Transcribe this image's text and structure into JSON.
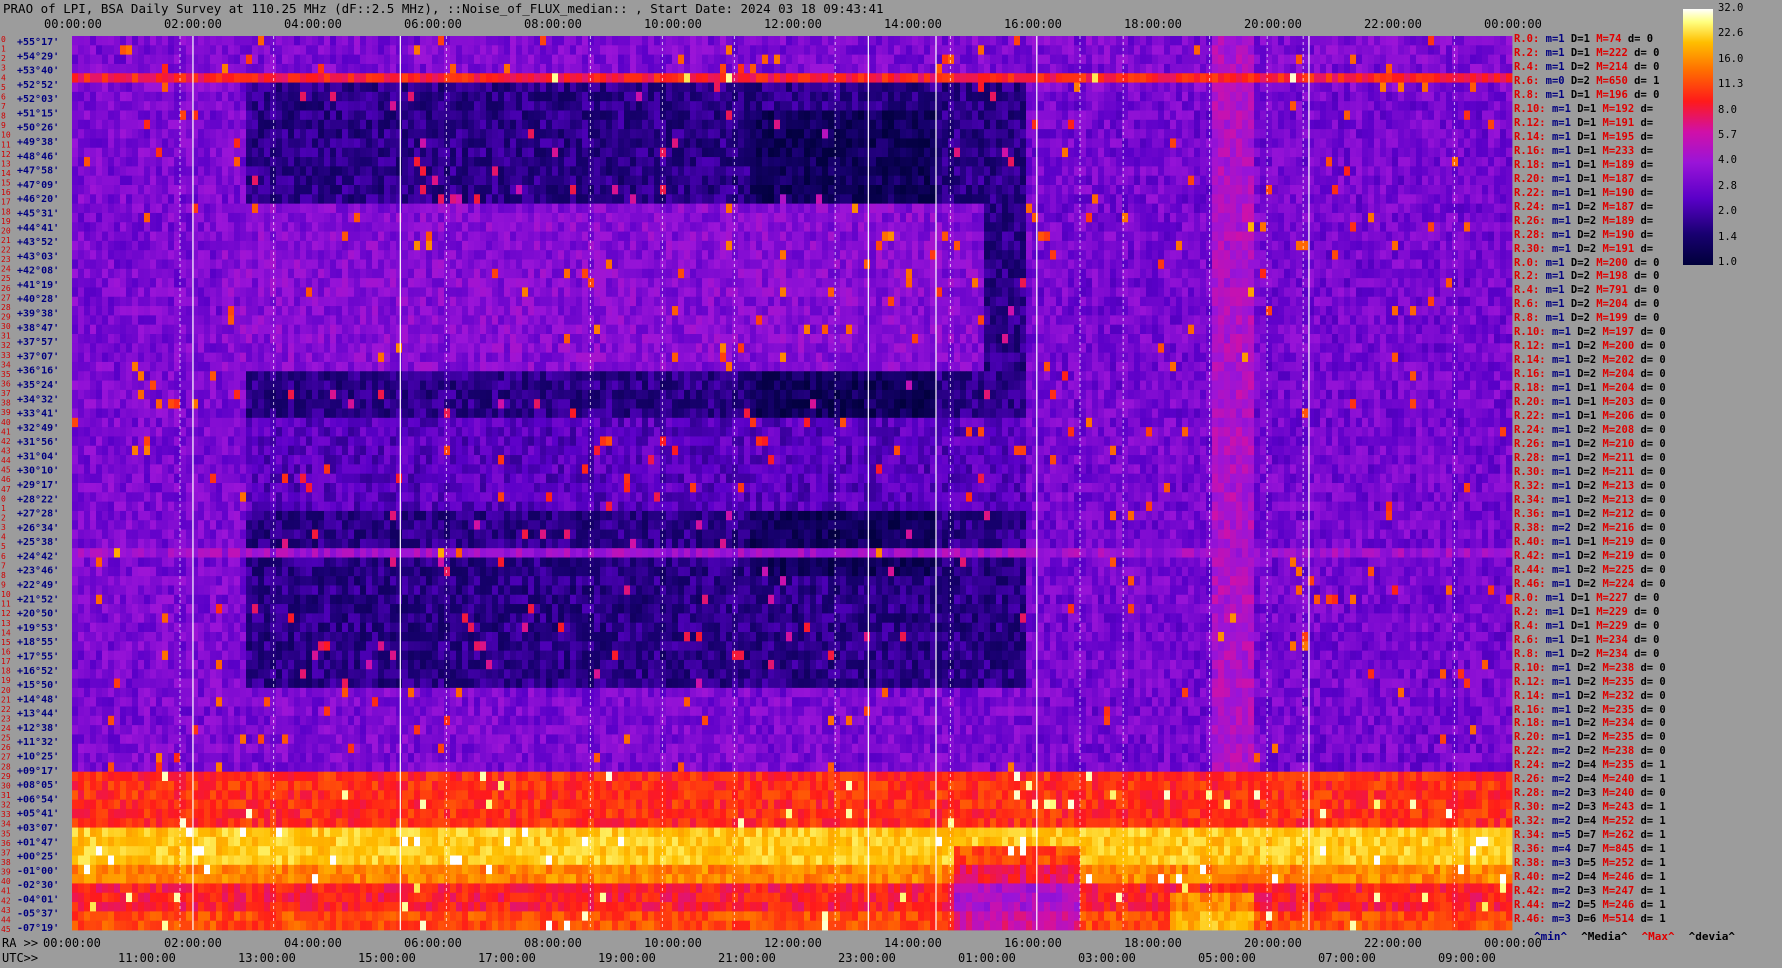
{
  "title": "PRAO of LPI, BSA Daily Survey at 110.25 MHz (dF::2.5 MHz), ::Noise_of_FLUX_median:: , Start Date: 2024 03 18 09:43:41",
  "chart_data": {
    "type": "heatmap",
    "title": "PRAO of LPI, BSA Daily Survey at 110.25 MHz (dF::2.5 MHz), ::Noise_of_FLUX_median:: , Start Date: 2024 03 18 09:43:41",
    "x_top_ticks": [
      "00:00:00",
      "02:00:00",
      "04:00:00",
      "06:00:00",
      "08:00:00",
      "10:00:00",
      "12:00:00",
      "14:00:00",
      "16:00:00",
      "18:00:00",
      "20:00:00",
      "22:00:00",
      "00:00:00"
    ],
    "x_bottom_ra_label": "RA >>",
    "x_bottom_ra_ticks": [
      "00:00:00",
      "02:00:00",
      "04:00:00",
      "06:00:00",
      "08:00:00",
      "10:00:00",
      "12:00:00",
      "14:00:00",
      "16:00:00",
      "18:00:00",
      "20:00:00",
      "22:00:00",
      "00:00:00"
    ],
    "x_bottom_utc_label": "UTC>>",
    "x_bottom_utc_ticks": [
      "11:00:00",
      "13:00:00",
      "15:00:00",
      "17:00:00",
      "19:00:00",
      "21:00:00",
      "23:00:00",
      "01:00:00",
      "03:00:00",
      "05:00:00",
      "07:00:00",
      "09:00:00"
    ],
    "y_ticks": [
      "+55°17'",
      "+54°29'",
      "+53°40'",
      "+52°52'",
      "+52°03'",
      "+51°15'",
      "+50°26'",
      "+49°38'",
      "+48°46'",
      "+47°58'",
      "+47°09'",
      "+46°20'",
      "+45°31'",
      "+44°41'",
      "+43°52'",
      "+43°03'",
      "+42°08'",
      "+41°19'",
      "+40°28'",
      "+39°38'",
      "+38°47'",
      "+37°57'",
      "+37°07'",
      "+36°16'",
      "+35°24'",
      "+34°32'",
      "+33°41'",
      "+32°49'",
      "+31°56'",
      "+31°04'",
      "+30°10'",
      "+29°17'",
      "+28°22'",
      "+27°28'",
      "+26°34'",
      "+25°38'",
      "+24°42'",
      "+23°46'",
      "+22°49'",
      "+21°52'",
      "+20°50'",
      "+19°53'",
      "+18°55'",
      "+17°55'",
      "+16°52'",
      "+15°50'",
      "+14°48'",
      "+13°44'",
      "+12°38'",
      "+11°32'",
      "+10°25'",
      "+09°17'",
      "+08°05'",
      "+06°54'",
      "+05°41'",
      "+03°07'",
      "+01°47'",
      "+00°25'",
      "-01°00'",
      "-02°30'",
      "-04°01'",
      "-05°37'",
      "-07°19'"
    ],
    "colorbar": {
      "ticks": [
        "32.0",
        "22.6",
        "16.0",
        "11.3",
        "8.0",
        "5.7",
        "4.0",
        "2.8",
        "2.0",
        "1.4",
        "1.0"
      ],
      "scale": "log",
      "colors": [
        "#00003a",
        "#180070",
        "#5a00c8",
        "#9a14d8",
        "#d010a8",
        "#ff1a1a",
        "#ff6e00",
        "#ffbe00",
        "#ffff80",
        "#ffffff"
      ]
    },
    "channel_stats": [
      {
        "r": "R.0:",
        "m": "m=1",
        "d": "D=1",
        "M": "M=74",
        "dd": "d= 0"
      },
      {
        "r": "R.2:",
        "m": "m=1",
        "d": "D=1",
        "M": "M=222",
        "dd": "d= 0"
      },
      {
        "r": "R.4:",
        "m": "m=1",
        "d": "D=2",
        "M": "M=214",
        "dd": "d= 0"
      },
      {
        "r": "R.6:",
        "m": "m=0",
        "d": "D=2",
        "M": "M=650",
        "dd": "d= 1"
      },
      {
        "r": "R.8:",
        "m": "m=1",
        "d": "D=1",
        "M": "M=196",
        "dd": "d= 0"
      },
      {
        "r": "R.10:",
        "m": "m=1",
        "d": "D=1",
        "M": "M=192",
        "dd": "d="
      },
      {
        "r": "R.12:",
        "m": "m=1",
        "d": "D=1",
        "M": "M=191",
        "dd": "d="
      },
      {
        "r": "R.14:",
        "m": "m=1",
        "d": "D=1",
        "M": "M=195",
        "dd": "d="
      },
      {
        "r": "R.16:",
        "m": "m=1",
        "d": "D=1",
        "M": "M=233",
        "dd": "d="
      },
      {
        "r": "R.18:",
        "m": "m=1",
        "d": "D=1",
        "M": "M=189",
        "dd": "d="
      },
      {
        "r": "R.20:",
        "m": "m=1",
        "d": "D=1",
        "M": "M=187",
        "dd": "d="
      },
      {
        "r": "R.22:",
        "m": "m=1",
        "d": "D=1",
        "M": "M=190",
        "dd": "d="
      },
      {
        "r": "R.24:",
        "m": "m=1",
        "d": "D=2",
        "M": "M=187",
        "dd": "d="
      },
      {
        "r": "R.26:",
        "m": "m=1",
        "d": "D=2",
        "M": "M=189",
        "dd": "d="
      },
      {
        "r": "R.28:",
        "m": "m=1",
        "d": "D=2",
        "M": "M=190",
        "dd": "d="
      },
      {
        "r": "R.30:",
        "m": "m=1",
        "d": "D=2",
        "M": "M=191",
        "dd": "d="
      },
      {
        "r": "R.0:",
        "m": "m=1",
        "d": "D=2",
        "M": "M=200",
        "dd": "d= 0"
      },
      {
        "r": "R.2:",
        "m": "m=1",
        "d": "D=2",
        "M": "M=198",
        "dd": "d= 0"
      },
      {
        "r": "R.4:",
        "m": "m=1",
        "d": "D=2",
        "M": "M=791",
        "dd": "d= 0"
      },
      {
        "r": "R.6:",
        "m": "m=1",
        "d": "D=2",
        "M": "M=204",
        "dd": "d= 0"
      },
      {
        "r": "R.8:",
        "m": "m=1",
        "d": "D=2",
        "M": "M=199",
        "dd": "d= 0"
      },
      {
        "r": "R.10:",
        "m": "m=1",
        "d": "D=2",
        "M": "M=197",
        "dd": "d= 0"
      },
      {
        "r": "R.12:",
        "m": "m=1",
        "d": "D=2",
        "M": "M=200",
        "dd": "d= 0"
      },
      {
        "r": "R.14:",
        "m": "m=1",
        "d": "D=2",
        "M": "M=202",
        "dd": "d= 0"
      },
      {
        "r": "R.16:",
        "m": "m=1",
        "d": "D=2",
        "M": "M=204",
        "dd": "d= 0"
      },
      {
        "r": "R.18:",
        "m": "m=1",
        "d": "D=1",
        "M": "M=204",
        "dd": "d= 0"
      },
      {
        "r": "R.20:",
        "m": "m=1",
        "d": "D=1",
        "M": "M=203",
        "dd": "d= 0"
      },
      {
        "r": "R.22:",
        "m": "m=1",
        "d": "D=1",
        "M": "M=206",
        "dd": "d= 0"
      },
      {
        "r": "R.24:",
        "m": "m=1",
        "d": "D=2",
        "M": "M=208",
        "dd": "d= 0"
      },
      {
        "r": "R.26:",
        "m": "m=1",
        "d": "D=2",
        "M": "M=210",
        "dd": "d= 0"
      },
      {
        "r": "R.28:",
        "m": "m=1",
        "d": "D=2",
        "M": "M=211",
        "dd": "d= 0"
      },
      {
        "r": "R.30:",
        "m": "m=1",
        "d": "D=2",
        "M": "M=211",
        "dd": "d= 0"
      },
      {
        "r": "R.32:",
        "m": "m=1",
        "d": "D=2",
        "M": "M=213",
        "dd": "d= 0"
      },
      {
        "r": "R.34:",
        "m": "m=1",
        "d": "D=2",
        "M": "M=213",
        "dd": "d= 0"
      },
      {
        "r": "R.36:",
        "m": "m=1",
        "d": "D=2",
        "M": "M=212",
        "dd": "d= 0"
      },
      {
        "r": "R.38:",
        "m": "m=2",
        "d": "D=2",
        "M": "M=216",
        "dd": "d= 0"
      },
      {
        "r": "R.40:",
        "m": "m=1",
        "d": "D=1",
        "M": "M=219",
        "dd": "d= 0"
      },
      {
        "r": "R.42:",
        "m": "m=1",
        "d": "D=2",
        "M": "M=219",
        "dd": "d= 0"
      },
      {
        "r": "R.44:",
        "m": "m=1",
        "d": "D=2",
        "M": "M=225",
        "dd": "d= 0"
      },
      {
        "r": "R.46:",
        "m": "m=1",
        "d": "D=2",
        "M": "M=224",
        "dd": "d= 0"
      },
      {
        "r": "R.0:",
        "m": "m=1",
        "d": "D=1",
        "M": "M=227",
        "dd": "d= 0"
      },
      {
        "r": "R.2:",
        "m": "m=1",
        "d": "D=1",
        "M": "M=229",
        "dd": "d= 0"
      },
      {
        "r": "R.4:",
        "m": "m=1",
        "d": "D=1",
        "M": "M=229",
        "dd": "d= 0"
      },
      {
        "r": "R.6:",
        "m": "m=1",
        "d": "D=1",
        "M": "M=234",
        "dd": "d= 0"
      },
      {
        "r": "R.8:",
        "m": "m=1",
        "d": "D=2",
        "M": "M=234",
        "dd": "d= 0"
      },
      {
        "r": "R.10:",
        "m": "m=1",
        "d": "D=2",
        "M": "M=238",
        "dd": "d= 0"
      },
      {
        "r": "R.12:",
        "m": "m=1",
        "d": "D=2",
        "M": "M=235",
        "dd": "d= 0"
      },
      {
        "r": "R.14:",
        "m": "m=1",
        "d": "D=2",
        "M": "M=232",
        "dd": "d= 0"
      },
      {
        "r": "R.16:",
        "m": "m=1",
        "d": "D=2",
        "M": "M=235",
        "dd": "d= 0"
      },
      {
        "r": "R.18:",
        "m": "m=1",
        "d": "D=2",
        "M": "M=234",
        "dd": "d= 0"
      },
      {
        "r": "R.20:",
        "m": "m=1",
        "d": "D=2",
        "M": "M=235",
        "dd": "d= 0"
      },
      {
        "r": "R.22:",
        "m": "m=2",
        "d": "D=2",
        "M": "M=238",
        "dd": "d= 0"
      },
      {
        "r": "R.24:",
        "m": "m=2",
        "d": "D=4",
        "M": "M=235",
        "dd": "d= 1"
      },
      {
        "r": "R.26:",
        "m": "m=2",
        "d": "D=4",
        "M": "M=240",
        "dd": "d= 1"
      },
      {
        "r": "R.28:",
        "m": "m=2",
        "d": "D=3",
        "M": "M=240",
        "dd": "d= 0"
      },
      {
        "r": "R.30:",
        "m": "m=2",
        "d": "D=3",
        "M": "M=243",
        "dd": "d= 1"
      },
      {
        "r": "R.32:",
        "m": "m=2",
        "d": "D=4",
        "M": "M=252",
        "dd": "d= 1"
      },
      {
        "r": "R.34:",
        "m": "m=5",
        "d": "D=7",
        "M": "M=262",
        "dd": "d= 1"
      },
      {
        "r": "R.36:",
        "m": "m=4",
        "d": "D=7",
        "M": "M=845",
        "dd": "d= 1"
      },
      {
        "r": "R.38:",
        "m": "m=3",
        "d": "D=5",
        "M": "M=252",
        "dd": "d= 1"
      },
      {
        "r": "R.40:",
        "m": "m=2",
        "d": "D=4",
        "M": "M=246",
        "dd": "d= 1"
      },
      {
        "r": "R.42:",
        "m": "m=2",
        "d": "D=3",
        "M": "M=247",
        "dd": "d= 1"
      },
      {
        "r": "R.44:",
        "m": "m=2",
        "d": "D=5",
        "M": "M=246",
        "dd": "d= 1"
      },
      {
        "r": "R.46:",
        "m": "m=3",
        "d": "D=6",
        "M": "M=514",
        "dd": "d= 1"
      }
    ],
    "stats_legend": [
      "^min^",
      "^Media^",
      "^Max^",
      "^devia^"
    ],
    "stats_legend_colors": [
      "#00007f",
      "#000000",
      "#e00000",
      "#000000"
    ]
  }
}
